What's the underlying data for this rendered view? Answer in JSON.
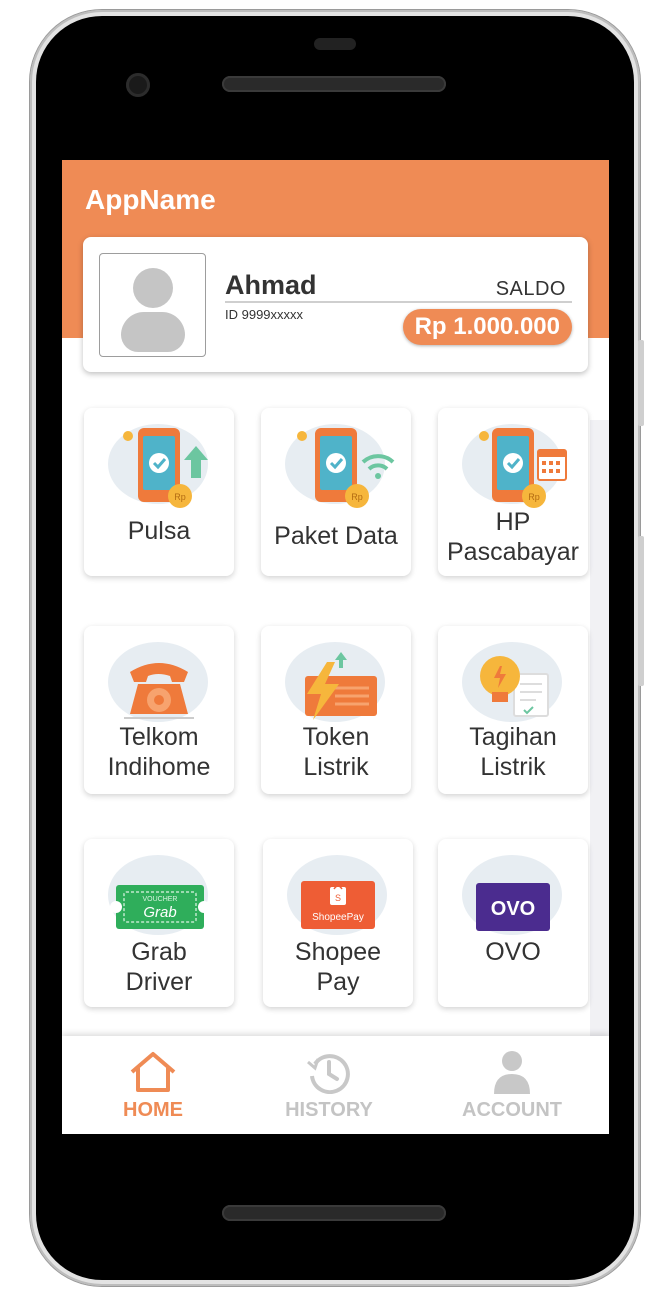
{
  "app": {
    "title": "AppName",
    "accent_color": "#ef8b55"
  },
  "profile": {
    "name": "Ahmad",
    "id_text": "ID 9999xxxxx",
    "saldo_label": "SALDO",
    "balance": "Rp 1.000.000",
    "avatar_icon": "user-avatar-icon"
  },
  "services": [
    {
      "lines": [
        "Pulsa"
      ],
      "icon": "phone-topup-icon"
    },
    {
      "lines": [
        "Paket Data"
      ],
      "icon": "phone-data-icon"
    },
    {
      "lines": [
        "HP",
        "Pascabayar"
      ],
      "icon": "phone-postpaid-icon"
    },
    {
      "lines": [
        "Telkom",
        "Indihome"
      ],
      "icon": "telephone-icon"
    },
    {
      "lines": [
        "Token",
        "Listrik"
      ],
      "icon": "lightning-token-icon"
    },
    {
      "lines": [
        "Tagihan",
        "Listrik"
      ],
      "icon": "lightbulb-bill-icon"
    },
    {
      "lines": [
        "Grab",
        "Driver"
      ],
      "icon": "grab-voucher-icon",
      "badge_text": "Grab",
      "badge_small": "VOUCHER"
    },
    {
      "lines": [
        "Shopee",
        "Pay"
      ],
      "icon": "shopeepay-icon",
      "badge_text": "ShopeePay"
    },
    {
      "lines": [
        "OVO"
      ],
      "icon": "ovo-icon",
      "badge_text": "OVO"
    }
  ],
  "nav": {
    "items": [
      {
        "label": "HOME",
        "icon": "home-icon",
        "active": true
      },
      {
        "label": "HISTORY",
        "icon": "history-icon",
        "active": false
      },
      {
        "label": "ACCOUNT",
        "icon": "account-icon",
        "active": false
      }
    ],
    "active_color": "#ef8b55",
    "inactive_color": "#bdbdbd"
  }
}
